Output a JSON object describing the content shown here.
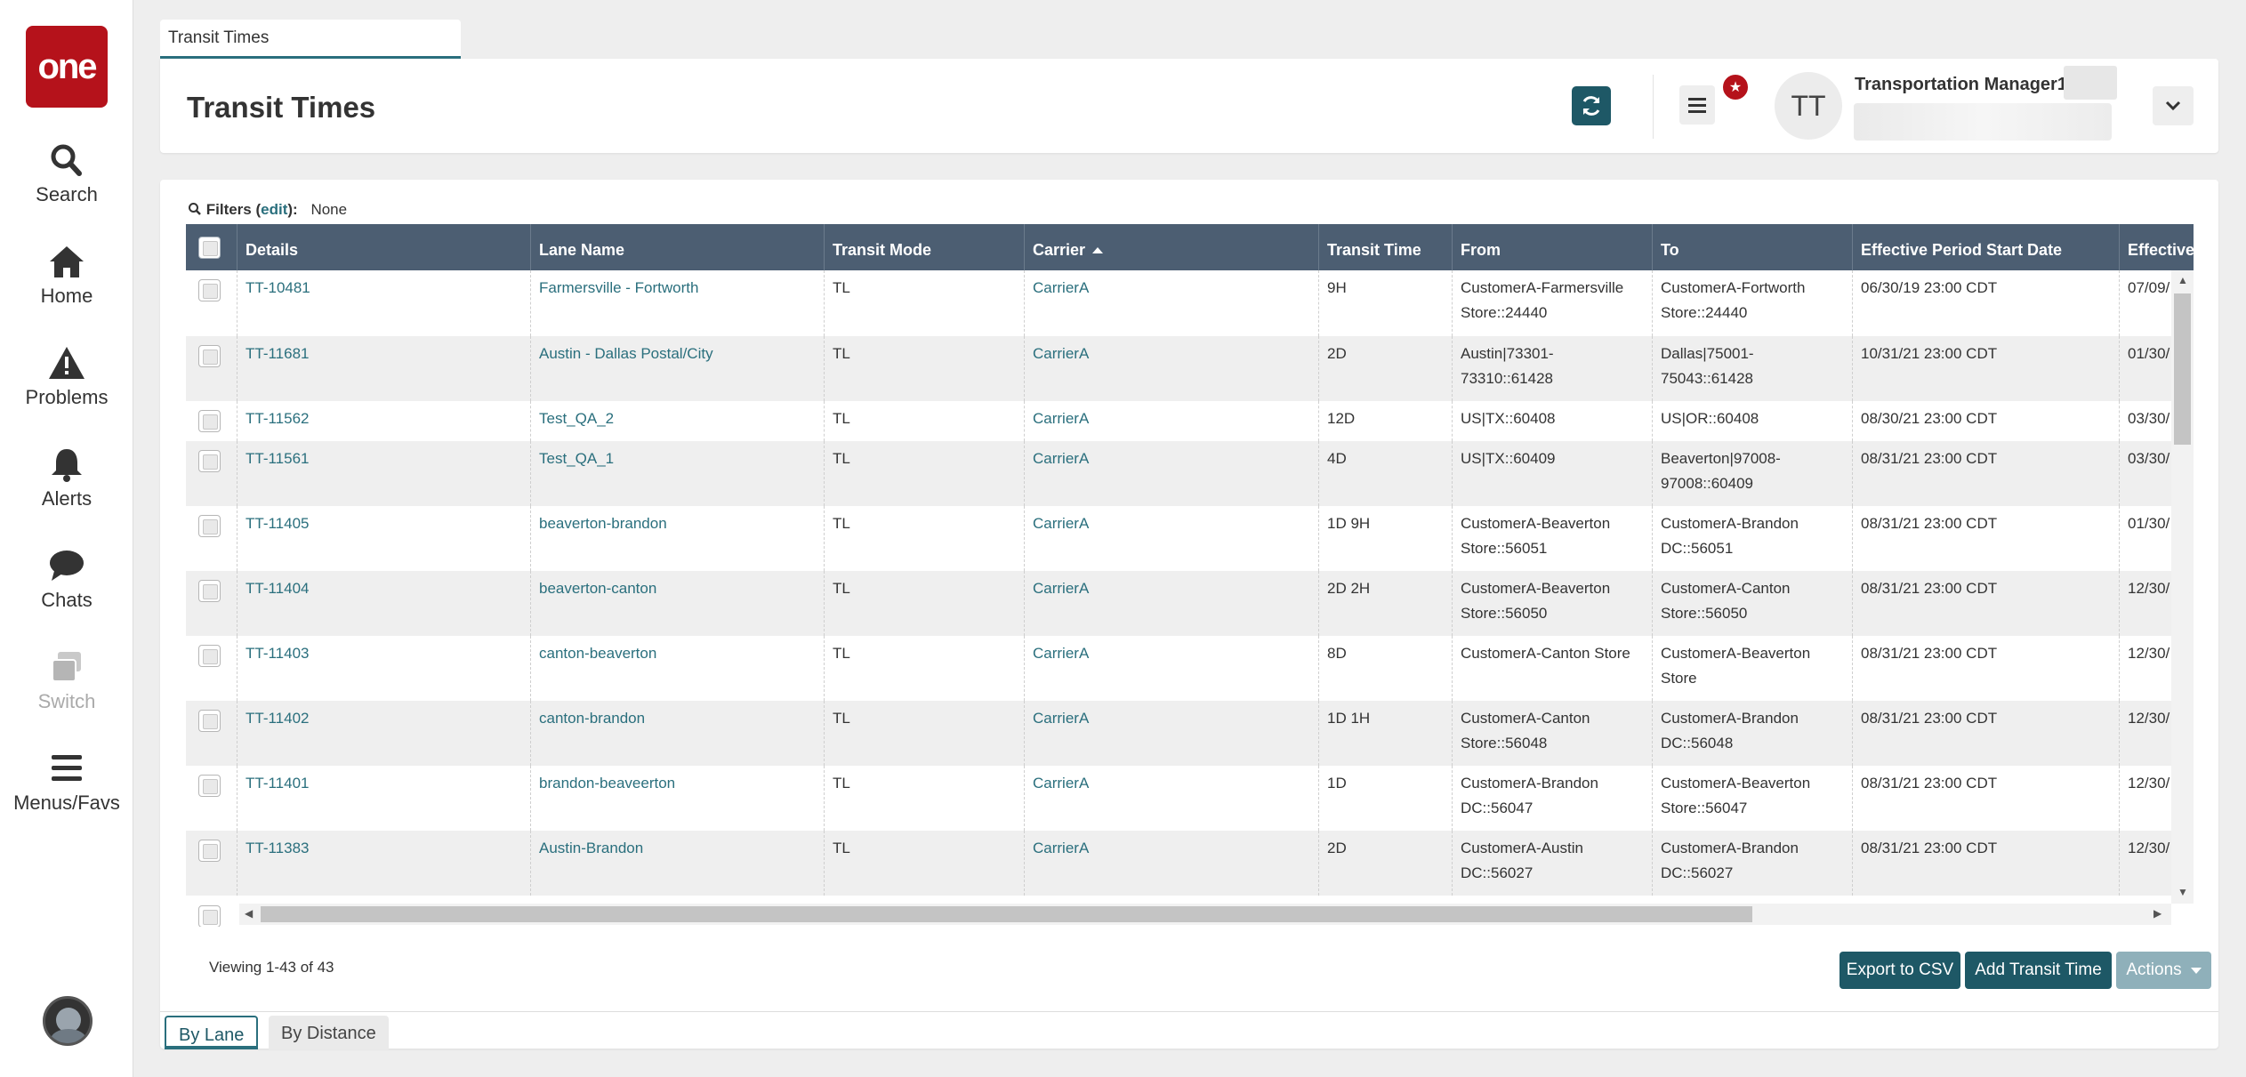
{
  "nav": {
    "logo": "one",
    "items": [
      {
        "label": "Search",
        "icon": "search-icon"
      },
      {
        "label": "Home",
        "icon": "home-icon"
      },
      {
        "label": "Problems",
        "icon": "warning-icon"
      },
      {
        "label": "Alerts",
        "icon": "bell-icon"
      },
      {
        "label": "Chats",
        "icon": "chat-icon"
      },
      {
        "label": "Switch",
        "icon": "switch-icon",
        "disabled": true
      },
      {
        "label": "Menus/Favs",
        "icon": "hamburger-icon"
      }
    ]
  },
  "tab": {
    "title": "Transit Times"
  },
  "header": {
    "title": "Transit Times",
    "user_initials": "TT",
    "user_name": "Transportation Manager1"
  },
  "filters": {
    "label": "Filters (",
    "edit": "edit",
    "close": "):",
    "value": "None"
  },
  "table": {
    "columns": [
      "Details",
      "Lane Name",
      "Transit Mode",
      "Carrier",
      "Transit Time",
      "From",
      "To",
      "Effective Period Start Date",
      "Effective"
    ],
    "sorted_column": "Carrier",
    "sort_direction": "ascending",
    "rows": [
      {
        "details": "TT-10481",
        "lane": "Farmersville - Fortworth",
        "mode": "TL",
        "carrier": "CarrierA",
        "time": "9H",
        "from": "CustomerA-Farmersville Store::24440",
        "to": "CustomerA-Fortworth Store::24440",
        "start": "06/30/19 23:00 CDT",
        "eff": "07/09/"
      },
      {
        "details": "TT-11681",
        "lane": "Austin - Dallas Postal/City",
        "mode": "TL",
        "carrier": "CarrierA",
        "time": "2D",
        "from": "Austin|73301-73310::61428",
        "to": "Dallas|75001-75043::61428",
        "start": "10/31/21 23:00 CDT",
        "eff": "01/30/"
      },
      {
        "details": "TT-11562",
        "lane": "Test_QA_2",
        "mode": "TL",
        "carrier": "CarrierA",
        "time": "12D",
        "from": "US|TX::60408",
        "to": "US|OR::60408",
        "start": "08/30/21 23:00 CDT",
        "eff": "03/30/"
      },
      {
        "details": "TT-11561",
        "lane": "Test_QA_1",
        "mode": "TL",
        "carrier": "CarrierA",
        "time": "4D",
        "from": "US|TX::60409",
        "to": "Beaverton|97008-97008::60409",
        "start": "08/31/21 23:00 CDT",
        "eff": "03/30/"
      },
      {
        "details": "TT-11405",
        "lane": "beaverton-brandon",
        "mode": "TL",
        "carrier": "CarrierA",
        "time": "1D 9H",
        "from": "CustomerA-Beaverton Store::56051",
        "to": "CustomerA-Brandon DC::56051",
        "start": "08/31/21 23:00 CDT",
        "eff": "01/30/"
      },
      {
        "details": "TT-11404",
        "lane": "beaverton-canton",
        "mode": "TL",
        "carrier": "CarrierA",
        "time": "2D 2H",
        "from": "CustomerA-Beaverton Store::56050",
        "to": "CustomerA-Canton Store::56050",
        "start": "08/31/21 23:00 CDT",
        "eff": "12/30/"
      },
      {
        "details": "TT-11403",
        "lane": "canton-beaverton",
        "mode": "TL",
        "carrier": "CarrierA",
        "time": "8D",
        "from": "CustomerA-Canton Store",
        "to": "CustomerA-Beaverton Store",
        "start": "08/31/21 23:00 CDT",
        "eff": "12/30/"
      },
      {
        "details": "TT-11402",
        "lane": "canton-brandon",
        "mode": "TL",
        "carrier": "CarrierA",
        "time": "1D 1H",
        "from": "CustomerA-Canton Store::56048",
        "to": "CustomerA-Brandon DC::56048",
        "start": "08/31/21 23:00 CDT",
        "eff": "12/30/"
      },
      {
        "details": "TT-11401",
        "lane": "brandon-beaveerton",
        "mode": "TL",
        "carrier": "CarrierA",
        "time": "1D",
        "from": "CustomerA-Brandon DC::56047",
        "to": "CustomerA-Beaverton Store::56047",
        "start": "08/31/21 23:00 CDT",
        "eff": "12/30/"
      },
      {
        "details": "TT-11383",
        "lane": "Austin-Brandon",
        "mode": "TL",
        "carrier": "CarrierA",
        "time": "2D",
        "from": "CustomerA-Austin DC::56027",
        "to": "CustomerA-Brandon DC::56027",
        "start": "08/31/21 23:00 CDT",
        "eff": "12/30/"
      }
    ]
  },
  "footer": {
    "viewing": "Viewing 1-43 of 43",
    "export_label": "Export to CSV",
    "add_label": "Add Transit Time",
    "actions_label": "Actions"
  },
  "bottom_tabs": [
    {
      "label": "By Lane",
      "active": true
    },
    {
      "label": "By Distance",
      "active": false
    }
  ],
  "colors": {
    "brand": "#b5121b",
    "accent": "#1e5866",
    "link": "#2a6f7d",
    "header_bg": "#4c5e72"
  }
}
